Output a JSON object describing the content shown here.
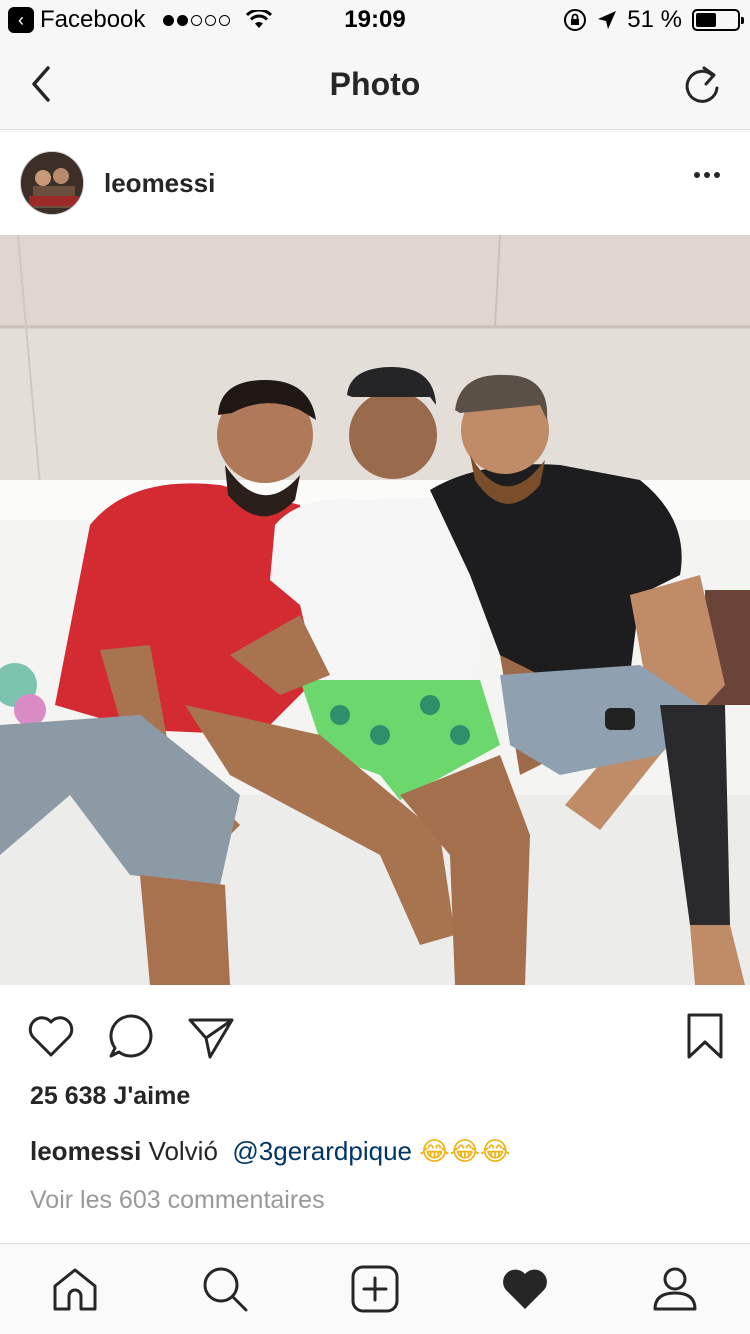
{
  "status_bar": {
    "back_app": "Facebook",
    "time": "19:09",
    "battery": "51 %",
    "battery_level": 0.51
  },
  "nav": {
    "title": "Photo"
  },
  "post": {
    "username": "leomessi",
    "likes": "25 638 J'aime",
    "caption_user": "leomessi",
    "caption_text": "Volvió",
    "caption_mention": "@3gerardpique",
    "caption_emoji": "😂😂😂",
    "comments_link": "Voir les 603 commentaires"
  },
  "icons": {
    "status": [
      "back-app-icon",
      "signal-icon",
      "wifi-icon",
      "lock-rotation-icon",
      "location-icon",
      "battery-icon"
    ],
    "nav": [
      "back-icon",
      "refresh-icon"
    ],
    "actions": [
      "heart-icon",
      "comment-icon",
      "share-icon",
      "bookmark-icon"
    ],
    "tabs": [
      "home-icon",
      "search-icon",
      "add-icon",
      "activity-heart-icon",
      "profile-icon"
    ]
  },
  "colors": {
    "text": "#262626",
    "muted": "#999999",
    "mention": "#003569",
    "bar_background": "#f7f7f7"
  }
}
